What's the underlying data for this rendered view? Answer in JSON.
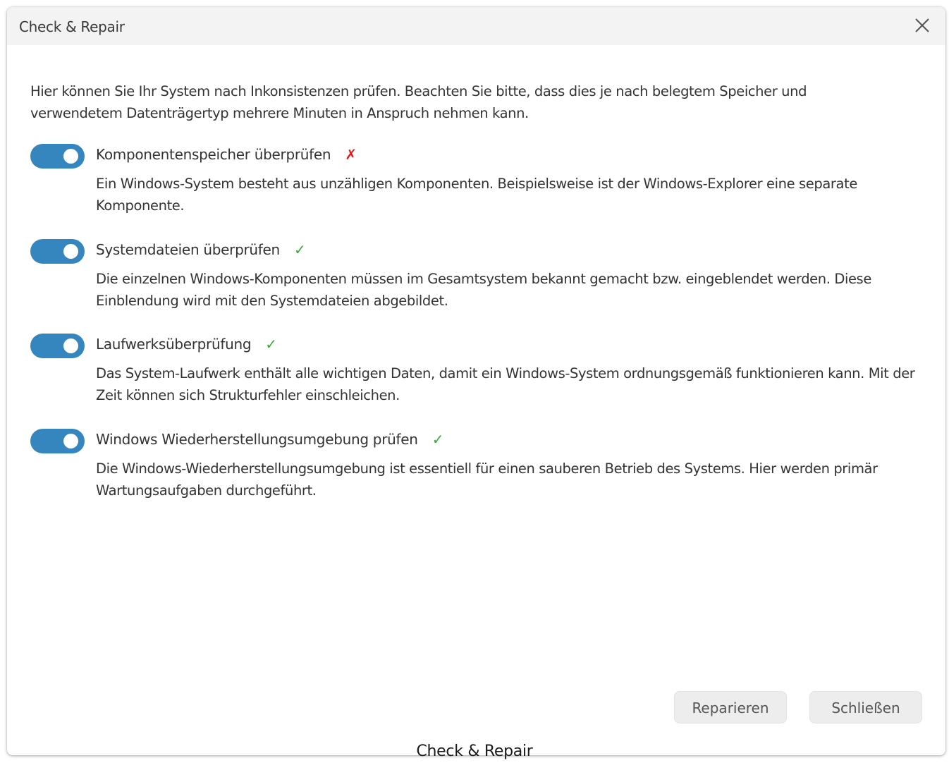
{
  "window": {
    "title": "Check & Repair",
    "close_icon": "close-icon"
  },
  "intro": "Hier können Sie Ihr System nach Inkonsistenzen prüfen. Beachten Sie bitte, dass dies je nach belegtem Speicher und verwendetem Datenträgertyp mehrere Minuten in Anspruch nehmen kann.",
  "options": [
    {
      "label": "Komponentenspeicher überprüfen",
      "enabled": true,
      "status": "fail",
      "status_glyph": "✗",
      "description": "Ein Windows-System besteht aus unzähligen Komponenten. Beispielsweise ist der Windows-Explorer eine separate Komponente."
    },
    {
      "label": "Systemdateien überprüfen",
      "enabled": true,
      "status": "ok",
      "status_glyph": "✓",
      "description": "Die einzelnen Windows-Komponenten müssen im Gesamtsystem bekannt gemacht bzw. eingeblendet werden. Diese Einblendung wird mit den Systemdateien abgebildet."
    },
    {
      "label": "Laufwerksüberprüfung",
      "enabled": true,
      "status": "ok",
      "status_glyph": "✓",
      "description": "Das System-Laufwerk enthält alle wichtigen Daten, damit ein Windows-System ordnungsgemäß funktionieren kann. Mit der Zeit können sich Strukturfehler einschleichen."
    },
    {
      "label": "Windows Wiederherstellungsumgebung prüfen",
      "enabled": true,
      "status": "ok",
      "status_glyph": "✓",
      "description": "Die Windows-Wiederherstellungsumgebung ist essentiell für einen sauberen Betrieb des Systems. Hier werden primär Wartungsaufgaben durchgeführt."
    }
  ],
  "buttons": {
    "repair_label": "Reparieren",
    "close_label": "Schließen"
  },
  "caption": "Check & Repair",
  "colors": {
    "toggle_on": "#3586bf",
    "status_fail": "#e11b1b",
    "status_ok": "#3aa83a",
    "titlebar_bg": "#f3f3f3"
  }
}
